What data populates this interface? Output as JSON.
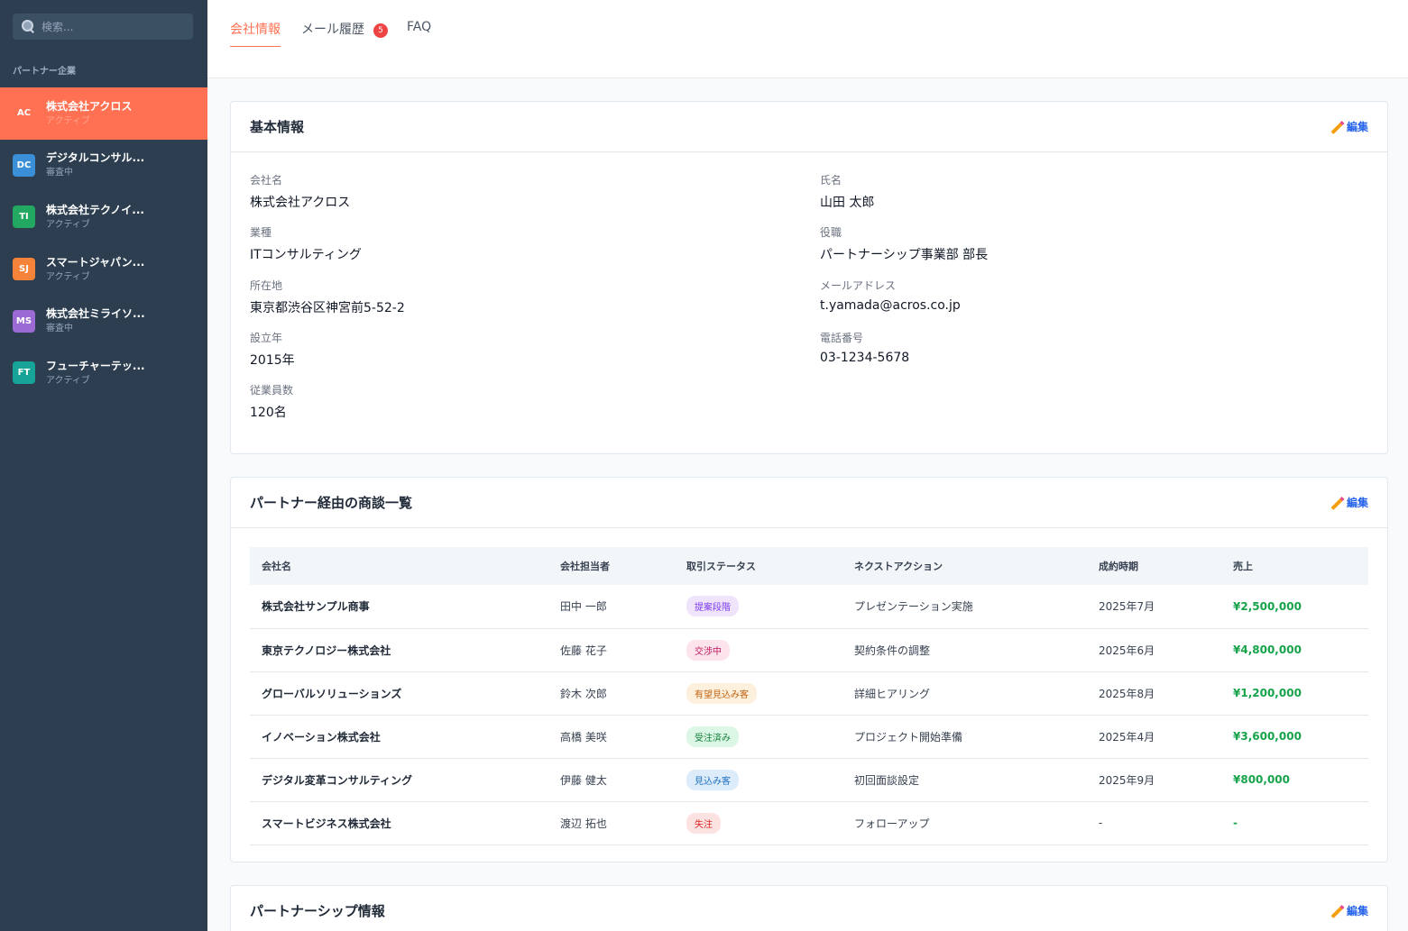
{
  "sidebar": {
    "search_placeholder": "検索...",
    "section_label": "パートナー企業",
    "partners": [
      {
        "initials": "AC",
        "name": "株式会社アクロス",
        "status": "アクティブ",
        "color": "#ff7152",
        "active": true
      },
      {
        "initials": "DC",
        "name": "デジタルコンサル...",
        "status": "審査中",
        "color": "#3b8fd9",
        "active": false
      },
      {
        "initials": "TI",
        "name": "株式会社テクノイ...",
        "status": "アクティブ",
        "color": "#22a861",
        "active": false
      },
      {
        "initials": "SJ",
        "name": "スマートジャパン...",
        "status": "アクティブ",
        "color": "#f5843a",
        "active": false
      },
      {
        "initials": "MS",
        "name": "株式会社ミライソ...",
        "status": "審査中",
        "color": "#9b6ad4",
        "active": false
      },
      {
        "initials": "FT",
        "name": "フューチャーテッ...",
        "status": "アクティブ",
        "color": "#17a398",
        "active": false
      }
    ]
  },
  "tabs": [
    {
      "label": "会社情報",
      "active": true
    },
    {
      "label": "メール履歴",
      "badge": "5",
      "active": false
    },
    {
      "label": "FAQ",
      "active": false
    }
  ],
  "basic_info": {
    "title": "基本情報",
    "edit_label": "編集",
    "left": [
      {
        "label": "会社名",
        "value": "株式会社アクロス"
      },
      {
        "label": "業種",
        "value": "ITコンサルティング"
      },
      {
        "label": "所在地",
        "value": "東京都渋谷区神宮前5-52-2"
      },
      {
        "label": "設立年",
        "value": "2015年"
      },
      {
        "label": "従業員数",
        "value": "120名"
      }
    ],
    "right": [
      {
        "label": "氏名",
        "value": "山田 太郎"
      },
      {
        "label": "役職",
        "value": "パートナーシップ事業部 部長"
      },
      {
        "label": "メールアドレス",
        "value": "t.yamada@acros.co.jp"
      },
      {
        "label": "電話番号",
        "value": "03-1234-5678"
      }
    ]
  },
  "deals": {
    "title": "パートナー経由の商談一覧",
    "edit_label": "編集",
    "columns": [
      "会社名",
      "会社担当者",
      "取引ステータス",
      "ネクストアクション",
      "成約時期",
      "売上"
    ],
    "rows": [
      {
        "company": "株式会社サンプル商事",
        "contact": "田中 一郎",
        "status": "提案段階",
        "status_bg": "#efe4fb",
        "status_fg": "#7c3aed",
        "next_action": "プレゼンテーション実施",
        "close_date": "2025年7月",
        "sales": "¥2,500,000"
      },
      {
        "company": "東京テクノロジー株式会社",
        "contact": "佐藤 花子",
        "status": "交渉中",
        "status_bg": "#fde4ec",
        "status_fg": "#be185d",
        "next_action": "契約条件の調整",
        "close_date": "2025年6月",
        "sales": "¥4,800,000"
      },
      {
        "company": "グローバルソリューションズ",
        "contact": "鈴木 次郎",
        "status": "有望見込み客",
        "status_bg": "#fdf0dc",
        "status_fg": "#c2620f",
        "next_action": "詳細ヒアリング",
        "close_date": "2025年8月",
        "sales": "¥1,200,000"
      },
      {
        "company": "イノベーション株式会社",
        "contact": "高橋 美咲",
        "status": "受注済み",
        "status_bg": "#dcf7e5",
        "status_fg": "#15803d",
        "next_action": "プロジェクト開始準備",
        "close_date": "2025年4月",
        "sales": "¥3,600,000"
      },
      {
        "company": "デジタル変革コンサルティング",
        "contact": "伊藤 健太",
        "status": "見込み客",
        "status_bg": "#dcecfb",
        "status_fg": "#1d6fbf",
        "next_action": "初回面談設定",
        "close_date": "2025年9月",
        "sales": "¥800,000"
      },
      {
        "company": "スマートビジネス株式会社",
        "contact": "渡辺 拓也",
        "status": "失注",
        "status_bg": "#fde2e2",
        "status_fg": "#dc2626",
        "next_action": "フォローアップ",
        "close_date": "-",
        "sales": "-"
      }
    ]
  },
  "partnership": {
    "title": "パートナーシップ情報",
    "edit_label": "編集"
  }
}
